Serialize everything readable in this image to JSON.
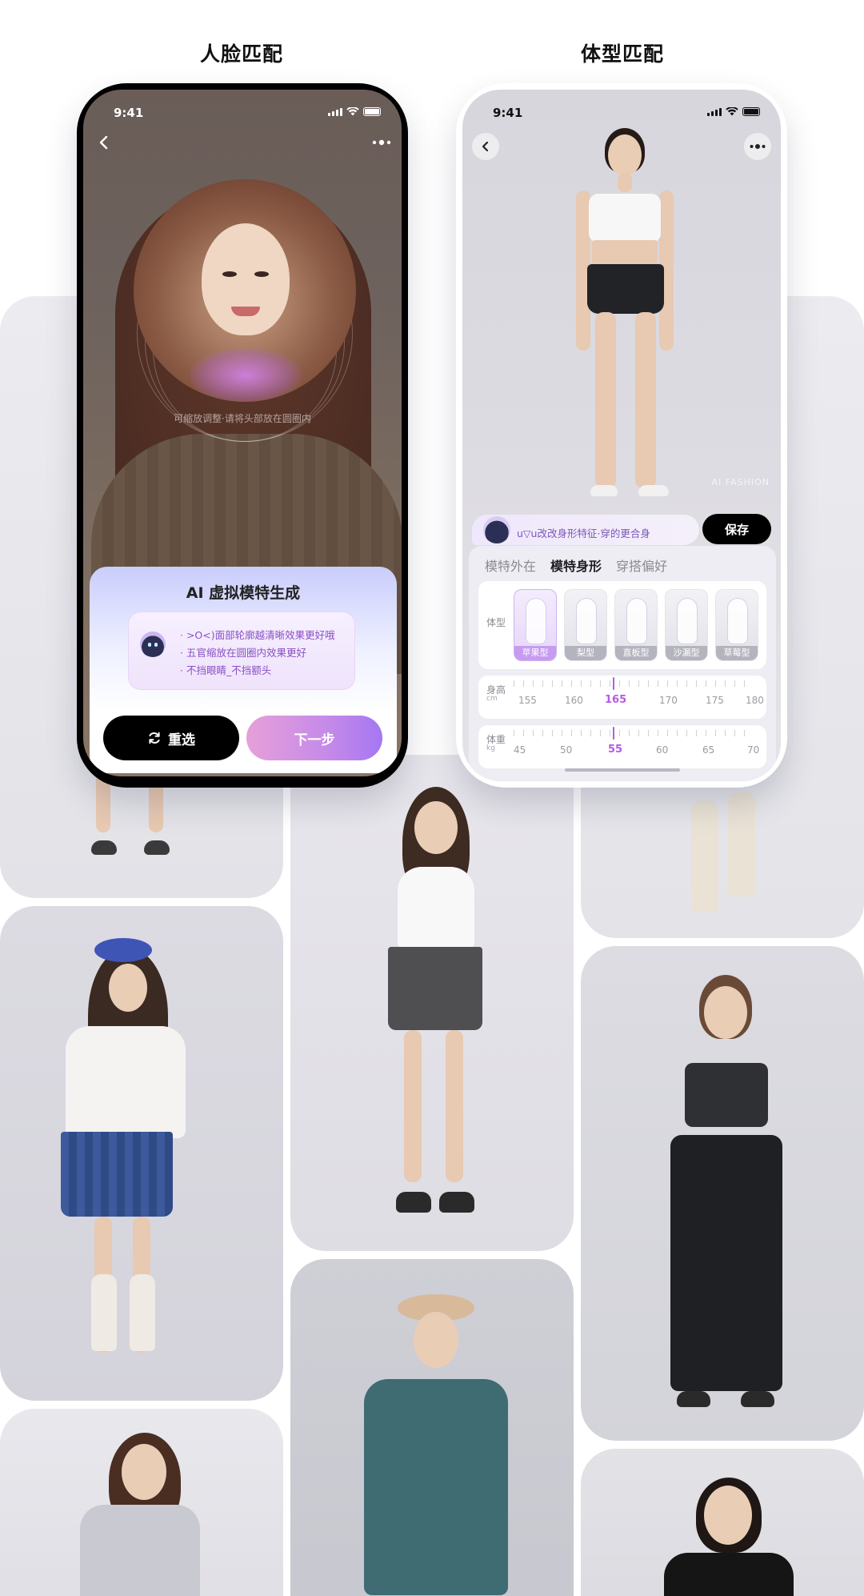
{
  "titles": {
    "left": "人脸匹配",
    "right": "体型匹配"
  },
  "status_bar": {
    "time": "9:41"
  },
  "face_match": {
    "hint": "可缩放调整·请将头部放在圆圈内",
    "card_title": "AI 虚拟模特生成",
    "tips": [
      "· >O<)面部轮廓越清晰效果更好哦",
      "· 五官缩放在圆圈内效果更好",
      "· 不挡眼睛_不挡额头"
    ],
    "reselect_label": "重选",
    "next_label": "下一步"
  },
  "body_match": {
    "watermark": "AI FASHION",
    "save_label": "保存",
    "bubble_text": "u▽u改改身形特征·穿的更合身",
    "tabs": [
      "模特外在",
      "模特身形",
      "穿搭偏好"
    ],
    "active_tab": 1,
    "shape_label": "体型",
    "shapes": [
      "苹果型",
      "梨型",
      "直板型",
      "沙漏型",
      "草莓型"
    ],
    "selected_shape": 0,
    "height": {
      "label": "身高",
      "unit": "cm",
      "ticks": [
        "155",
        "160",
        "165",
        "170",
        "175",
        "180"
      ],
      "value": "165"
    },
    "weight": {
      "label": "体重",
      "unit": "kg",
      "ticks": [
        "45",
        "50",
        "55",
        "60",
        "65",
        "70"
      ],
      "value": "55"
    }
  },
  "colors": {
    "accent": "#b45be0",
    "primary_button": "#000000",
    "gradient_start": "#e6a0d8",
    "gradient_end": "#a577f2"
  }
}
